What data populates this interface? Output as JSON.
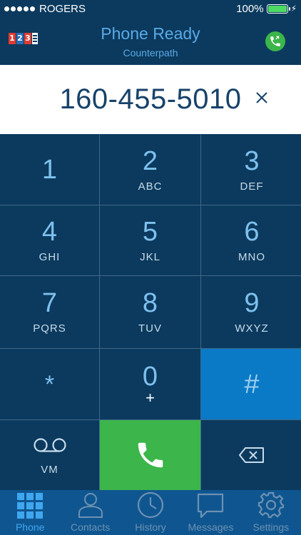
{
  "status_bar": {
    "carrier": "ROGERS",
    "battery_percent": "100%",
    "battery_level": 1.0,
    "signal_icon": "signal-dots-icon",
    "charging_icon": "bolt-icon"
  },
  "header": {
    "logo_digits": [
      "1",
      "2",
      "3"
    ],
    "title": "Phone Ready",
    "subtitle": "Counterpath",
    "status_icon": "phone-ready-icon"
  },
  "dialer": {
    "number": "160-455-5010",
    "clear_icon": "close-icon"
  },
  "keypad": {
    "keys": [
      {
        "digit": "1",
        "letters": ""
      },
      {
        "digit": "2",
        "letters": "ABC"
      },
      {
        "digit": "3",
        "letters": "DEF"
      },
      {
        "digit": "4",
        "letters": "GHI"
      },
      {
        "digit": "5",
        "letters": "JKL"
      },
      {
        "digit": "6",
        "letters": "MNO"
      },
      {
        "digit": "7",
        "letters": "PQRS"
      },
      {
        "digit": "8",
        "letters": "TUV"
      },
      {
        "digit": "9",
        "letters": "WXYZ"
      },
      {
        "digit": "*",
        "letters": ""
      },
      {
        "digit": "0",
        "letters": "+"
      },
      {
        "digit": "#",
        "letters": ""
      }
    ],
    "voicemail_label": "VM",
    "voicemail_icon": "voicemail-icon",
    "call_icon": "phone-handset-icon",
    "backspace_icon": "backspace-icon"
  },
  "tabbar": {
    "tabs": [
      {
        "label": "Phone",
        "icon": "keypad-grid-icon",
        "active": true
      },
      {
        "label": "Contacts",
        "icon": "person-icon",
        "active": false
      },
      {
        "label": "History",
        "icon": "clock-icon",
        "active": false
      },
      {
        "label": "Messages",
        "icon": "chat-bubble-icon",
        "active": false
      },
      {
        "label": "Settings",
        "icon": "gear-icon",
        "active": false
      }
    ]
  },
  "colors": {
    "background": "#0b3a5e",
    "accent": "#5aa9e6",
    "call_green": "#3cb54a",
    "hash_blue": "#0a7ac6",
    "tabbar": "#0f5690"
  }
}
